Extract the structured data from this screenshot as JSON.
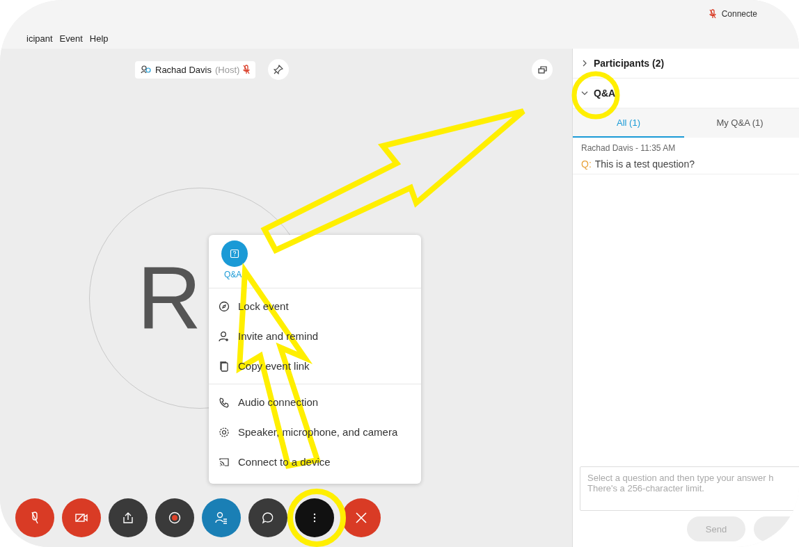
{
  "status": {
    "text": "Connecte",
    "mic_muted": true
  },
  "menu_bar": [
    {
      "label": "icipant"
    },
    {
      "label": "Event"
    },
    {
      "label": "Help"
    }
  ],
  "host": {
    "name": "Rachad Davis",
    "role": "(Host)",
    "muted": true
  },
  "avatar": {
    "initials": "R"
  },
  "more_menu": {
    "featured": {
      "label": "Q&A"
    },
    "groups": [
      [
        {
          "kind": "lock",
          "label": "Lock event"
        },
        {
          "kind": "invite",
          "label": "Invite and remind"
        },
        {
          "kind": "copy",
          "label": "Copy event link"
        }
      ],
      [
        {
          "kind": "audio",
          "label": "Audio connection"
        },
        {
          "kind": "settings",
          "label": "Speaker, microphone, and camera"
        },
        {
          "kind": "cast",
          "label": "Connect to a device"
        }
      ]
    ]
  },
  "toolbar": [
    {
      "kind": "mute"
    },
    {
      "kind": "video"
    },
    {
      "kind": "share"
    },
    {
      "kind": "record"
    },
    {
      "kind": "participants"
    },
    {
      "kind": "chat"
    },
    {
      "kind": "more"
    },
    {
      "kind": "leave"
    }
  ],
  "panel": {
    "sections": [
      {
        "title": "Participants (2)",
        "expanded": false
      },
      {
        "title": "Q&A",
        "expanded": true,
        "tabs": [
          {
            "label": "All (1)",
            "selected": true
          },
          {
            "label": "My Q&A (1)",
            "selected": false
          }
        ],
        "questions": [
          {
            "author": "Rachad Davis - 11:35 AM",
            "prefix": "Q:",
            "text": "This is a test question?"
          }
        ]
      }
    ],
    "answer": {
      "placeholder": "Select a question and then type your answer h\nThere's a 256-character limit."
    },
    "buttons": [
      {
        "label": "Send",
        "disabled": true
      },
      {
        "disabled": true
      }
    ]
  }
}
